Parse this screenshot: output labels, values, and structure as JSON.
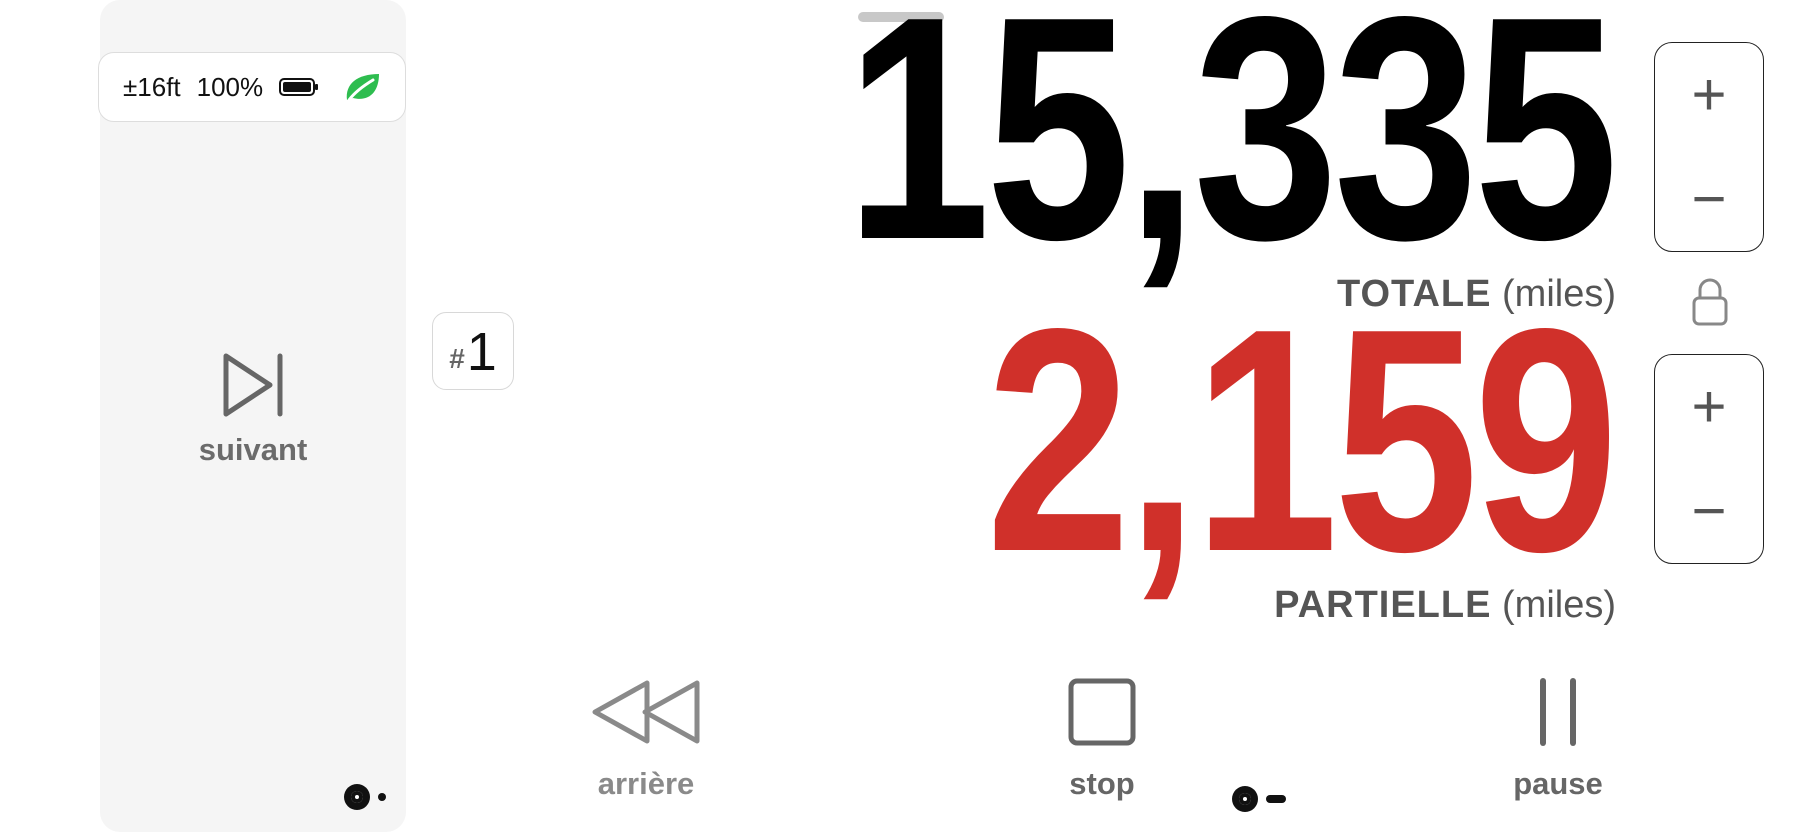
{
  "status": {
    "accuracy": "±16ft",
    "battery": "100%",
    "battery_icon": "battery-full-icon",
    "eco_icon": "leaf-icon",
    "eco_color": "#2ebd4f"
  },
  "next": {
    "label": "suivant",
    "icon": "skip-forward-icon"
  },
  "trip": {
    "hash": "#",
    "number": "1"
  },
  "odometer": {
    "total": {
      "value": "15,335",
      "label": "TOTALE",
      "unit": "(miles)",
      "color": "#000000"
    },
    "partial": {
      "value": "2,159",
      "label": "PARTIELLE",
      "unit": "(miles)",
      "color": "#d0302a"
    }
  },
  "steppers": {
    "plus": "+",
    "minus": "−"
  },
  "controls": {
    "rewind": {
      "label": "arrière",
      "icon": "rewind-icon",
      "color": "#8a8a8a"
    },
    "stop": {
      "label": "stop",
      "icon": "stop-icon",
      "color": "#666666"
    },
    "pause": {
      "label": "pause",
      "icon": "pause-icon",
      "color": "#666666"
    }
  }
}
